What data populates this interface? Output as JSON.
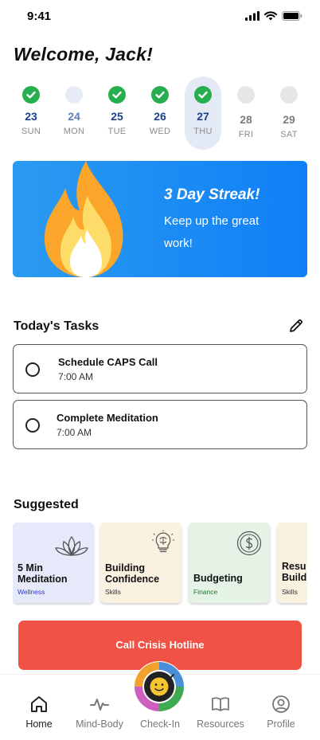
{
  "status": {
    "time": "9:41"
  },
  "greeting": "Welcome, Jack!",
  "week": [
    {
      "num": "23",
      "day": "SUN",
      "state": "done"
    },
    {
      "num": "24",
      "day": "MON",
      "state": "pending"
    },
    {
      "num": "25",
      "day": "TUE",
      "state": "done"
    },
    {
      "num": "26",
      "day": "WED",
      "state": "done"
    },
    {
      "num": "27",
      "day": "THU",
      "state": "done"
    },
    {
      "num": "28",
      "day": "FRI",
      "state": "future"
    },
    {
      "num": "29",
      "day": "SAT",
      "state": "future"
    }
  ],
  "streak": {
    "title": "3 Day Streak!",
    "message": "Keep up the great work!"
  },
  "tasks": {
    "title": "Today's Tasks",
    "items": [
      {
        "title": "Schedule CAPS Call",
        "time": "7:00 AM"
      },
      {
        "title": "Complete Meditation",
        "time": "7:00 AM"
      }
    ]
  },
  "suggested": {
    "title": "Suggested",
    "cards": [
      {
        "title_line1": "5 Min",
        "title_line2": "Meditation",
        "tag": "Wellness",
        "icon": "lotus-icon",
        "bg": "#e6e9fa",
        "tag_color": "#2a3bd6"
      },
      {
        "title_line1": "Building",
        "title_line2": "Confidence",
        "tag": "Skills",
        "icon": "lightbulb-brain-icon",
        "bg": "#fbf1e1",
        "tag_color": "#333333"
      },
      {
        "title_line1": "Budgeting",
        "title_line2": "",
        "tag": "Finance",
        "icon": "dollar-coin-icon",
        "bg": "#e5f3e6",
        "tag_color": "#1f7a2a"
      },
      {
        "title_line1": "Resu",
        "title_line2": "Build",
        "tag": "Skills",
        "icon": "",
        "bg": "#fbf1e1",
        "tag_color": "#333333"
      }
    ]
  },
  "crisis_button": "Call Crisis Hotline",
  "tabs": [
    {
      "label": "Home",
      "icon": "home-icon",
      "active": true
    },
    {
      "label": "Mind-Body",
      "icon": "pulse-icon",
      "active": false
    },
    {
      "label": "Check-In",
      "icon": "smiley-ring-icon",
      "active": false
    },
    {
      "label": "Resources",
      "icon": "book-icon",
      "active": false
    },
    {
      "label": "Profile",
      "icon": "user-icon",
      "active": false
    }
  ],
  "colors": {
    "accent_blue": "#0f7ff7",
    "done_green": "#27ae4f",
    "crisis_red": "#f05246"
  }
}
